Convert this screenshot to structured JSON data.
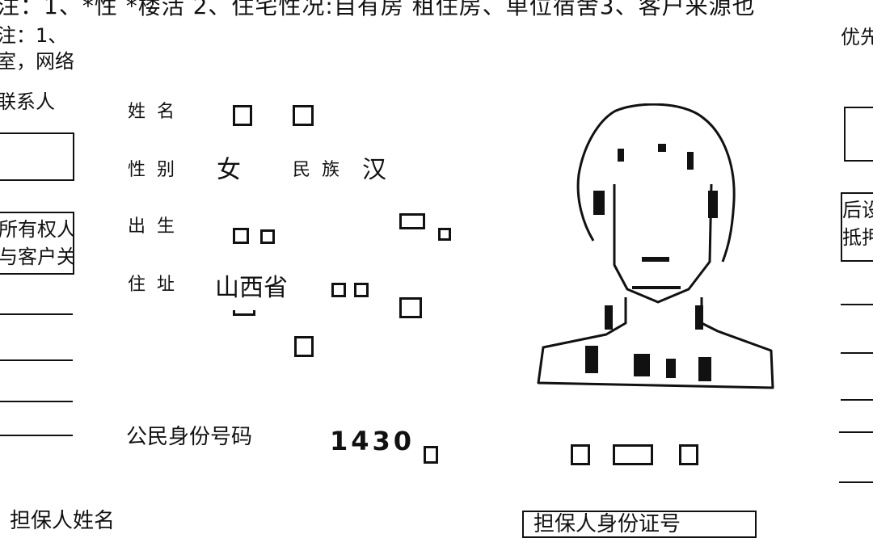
{
  "background": {
    "top_line": "注：1、*性 *楼活 2、住宅性况:自有房  租住房、单位宿舍3、客户来源也",
    "left_lines": [
      "注：1、",
      "室，网络",
      "联系人"
    ],
    "left_box_texts": [
      "所有权人",
      "与客户关"
    ],
    "right_fragments": [
      "优先",
      "后设",
      "抵押"
    ],
    "bottom_left": "担保人姓名",
    "bottom_right": "担保人身份证号"
  },
  "id_card": {
    "name_label": "姓名",
    "gender_label": "性别",
    "gender_value": "女",
    "ethnicity_label": "民族",
    "ethnicity_value": "汉",
    "birth_label": "出生",
    "address_label": "住址",
    "address_value": "山西省",
    "id_number_label": "公民身份号码",
    "id_number_value": "1430"
  }
}
